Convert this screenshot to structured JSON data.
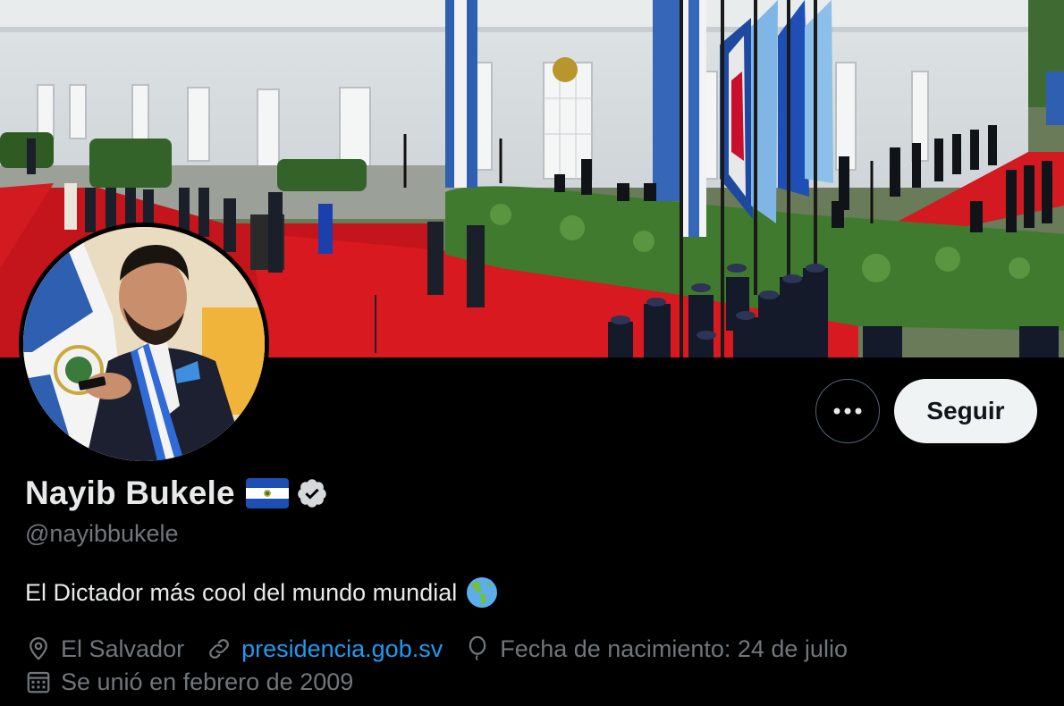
{
  "banner": {
    "alt": "Banner"
  },
  "profile": {
    "display_name": "Nayib Bukele",
    "handle": "@nayibbukele",
    "bio": "El Dictador más cool del mundo mundial",
    "location": "El Salvador",
    "website": "presidencia.gob.sv",
    "birthday": "Fecha de nacimiento: 24 de julio",
    "joined": "Se unió en febrero de 2009"
  },
  "actions": {
    "follow_label": "Seguir"
  },
  "colors": {
    "background": "#000000",
    "primary_text": "#e7e9ea",
    "secondary_text": "#71767b",
    "link": "#1d9bf0",
    "follow_bg": "#eff3f4"
  },
  "icons": {
    "more": "more-dots-icon",
    "verified": "verified-badge-icon",
    "location": "location-pin-icon",
    "link": "link-icon",
    "birthday": "balloon-icon",
    "calendar": "calendar-icon",
    "flag": "el-salvador-flag-emoji",
    "globe": "globe-americas-emoji"
  }
}
